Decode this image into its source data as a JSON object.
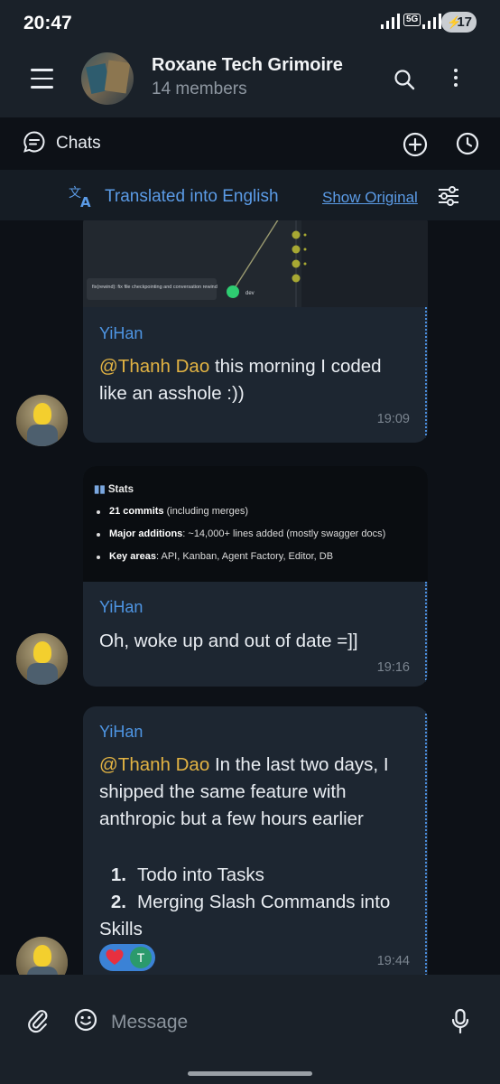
{
  "status_bar": {
    "time": "20:47",
    "network": "5G",
    "battery": "17"
  },
  "header": {
    "title": "Roxane Tech Grimoire",
    "subtitle": "14 members",
    "icons": [
      "menu-icon",
      "search-icon",
      "more-vertical-icon"
    ]
  },
  "chats_bar": {
    "label": "Chats",
    "icons": [
      "chat-bubble-icon",
      "add-circle-icon",
      "clock-history-icon"
    ]
  },
  "translate_bar": {
    "text": "Translated into English",
    "show_original": "Show Original",
    "icons": [
      "translate-icon",
      "filter-sliders-icon"
    ]
  },
  "messages": [
    {
      "image_caption": "fix(rewind): fix file checkpointing and conversation rewind",
      "image_branch": "dev",
      "sender": "YiHan",
      "mention": "@Thanh Dao",
      "text": " this morning I coded like an asshole :))",
      "time": "19:09"
    },
    {
      "stats": {
        "heading": "Stats",
        "items": [
          {
            "bold": "21 commits",
            "rest": " (including merges)"
          },
          {
            "bold": "Major additions",
            "rest": ": ~14,000+ lines added (mostly swagger docs)"
          },
          {
            "bold": "Key areas",
            "rest": ": API, Kanban, Agent Factory, Editor, DB"
          }
        ]
      },
      "sender": "YiHan",
      "text": "Oh, woke up and out of date =]]",
      "time": "19:16"
    },
    {
      "sender": "YiHan",
      "mention": "@Thanh Dao",
      "text": " In the last two days, I shipped the same feature with anthropic but a few hours earlier",
      "list": [
        {
          "num": "1.",
          "text": "Todo into Tasks"
        },
        {
          "num": "2.",
          "text": "Merging Slash Commands into Skills"
        }
      ],
      "reaction_emoji": "heart",
      "reactor_initial": "T",
      "time": "19:44"
    }
  ],
  "input": {
    "placeholder": "Message",
    "icons": [
      "paperclip-icon",
      "emoji-smile-icon",
      "microphone-icon"
    ]
  },
  "colors": {
    "background": "#0d1117",
    "bar": "#1a2129",
    "bubble": "#1d2631",
    "sender": "#4e95e3",
    "mention": "#e2b343",
    "link": "#5b9be6"
  }
}
